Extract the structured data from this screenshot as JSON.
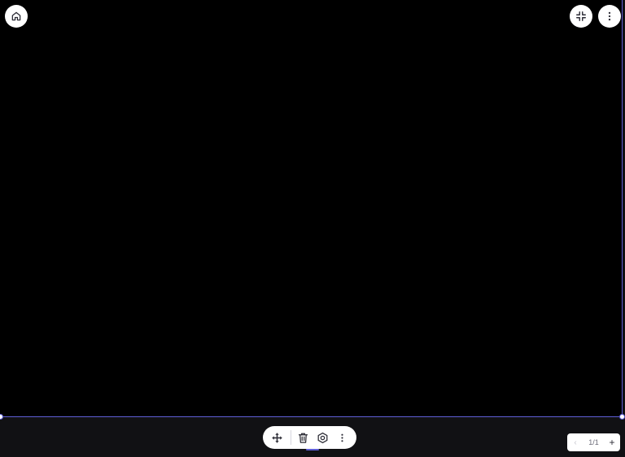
{
  "app": {
    "accent_color": "#5f5fd6",
    "canvas_color": "#000000",
    "chrome_color": "#111114"
  },
  "top_left": {
    "home_button": {
      "icon": "home-icon"
    }
  },
  "top_right": {
    "exit_fullscreen_button": {
      "icon": "exit-fullscreen-icon"
    },
    "more_button": {
      "icon": "more-vertical-icon"
    }
  },
  "toolbar": {
    "items": [
      {
        "name": "move",
        "icon": "move-arrows-icon"
      },
      {
        "name": "delete",
        "icon": "trash-icon"
      },
      {
        "name": "settings",
        "icon": "gear-icon"
      },
      {
        "name": "more",
        "icon": "more-vertical-icon"
      }
    ]
  },
  "pager": {
    "prev_symbol": "‹",
    "page_label": "1/1",
    "add_symbol": "+"
  }
}
